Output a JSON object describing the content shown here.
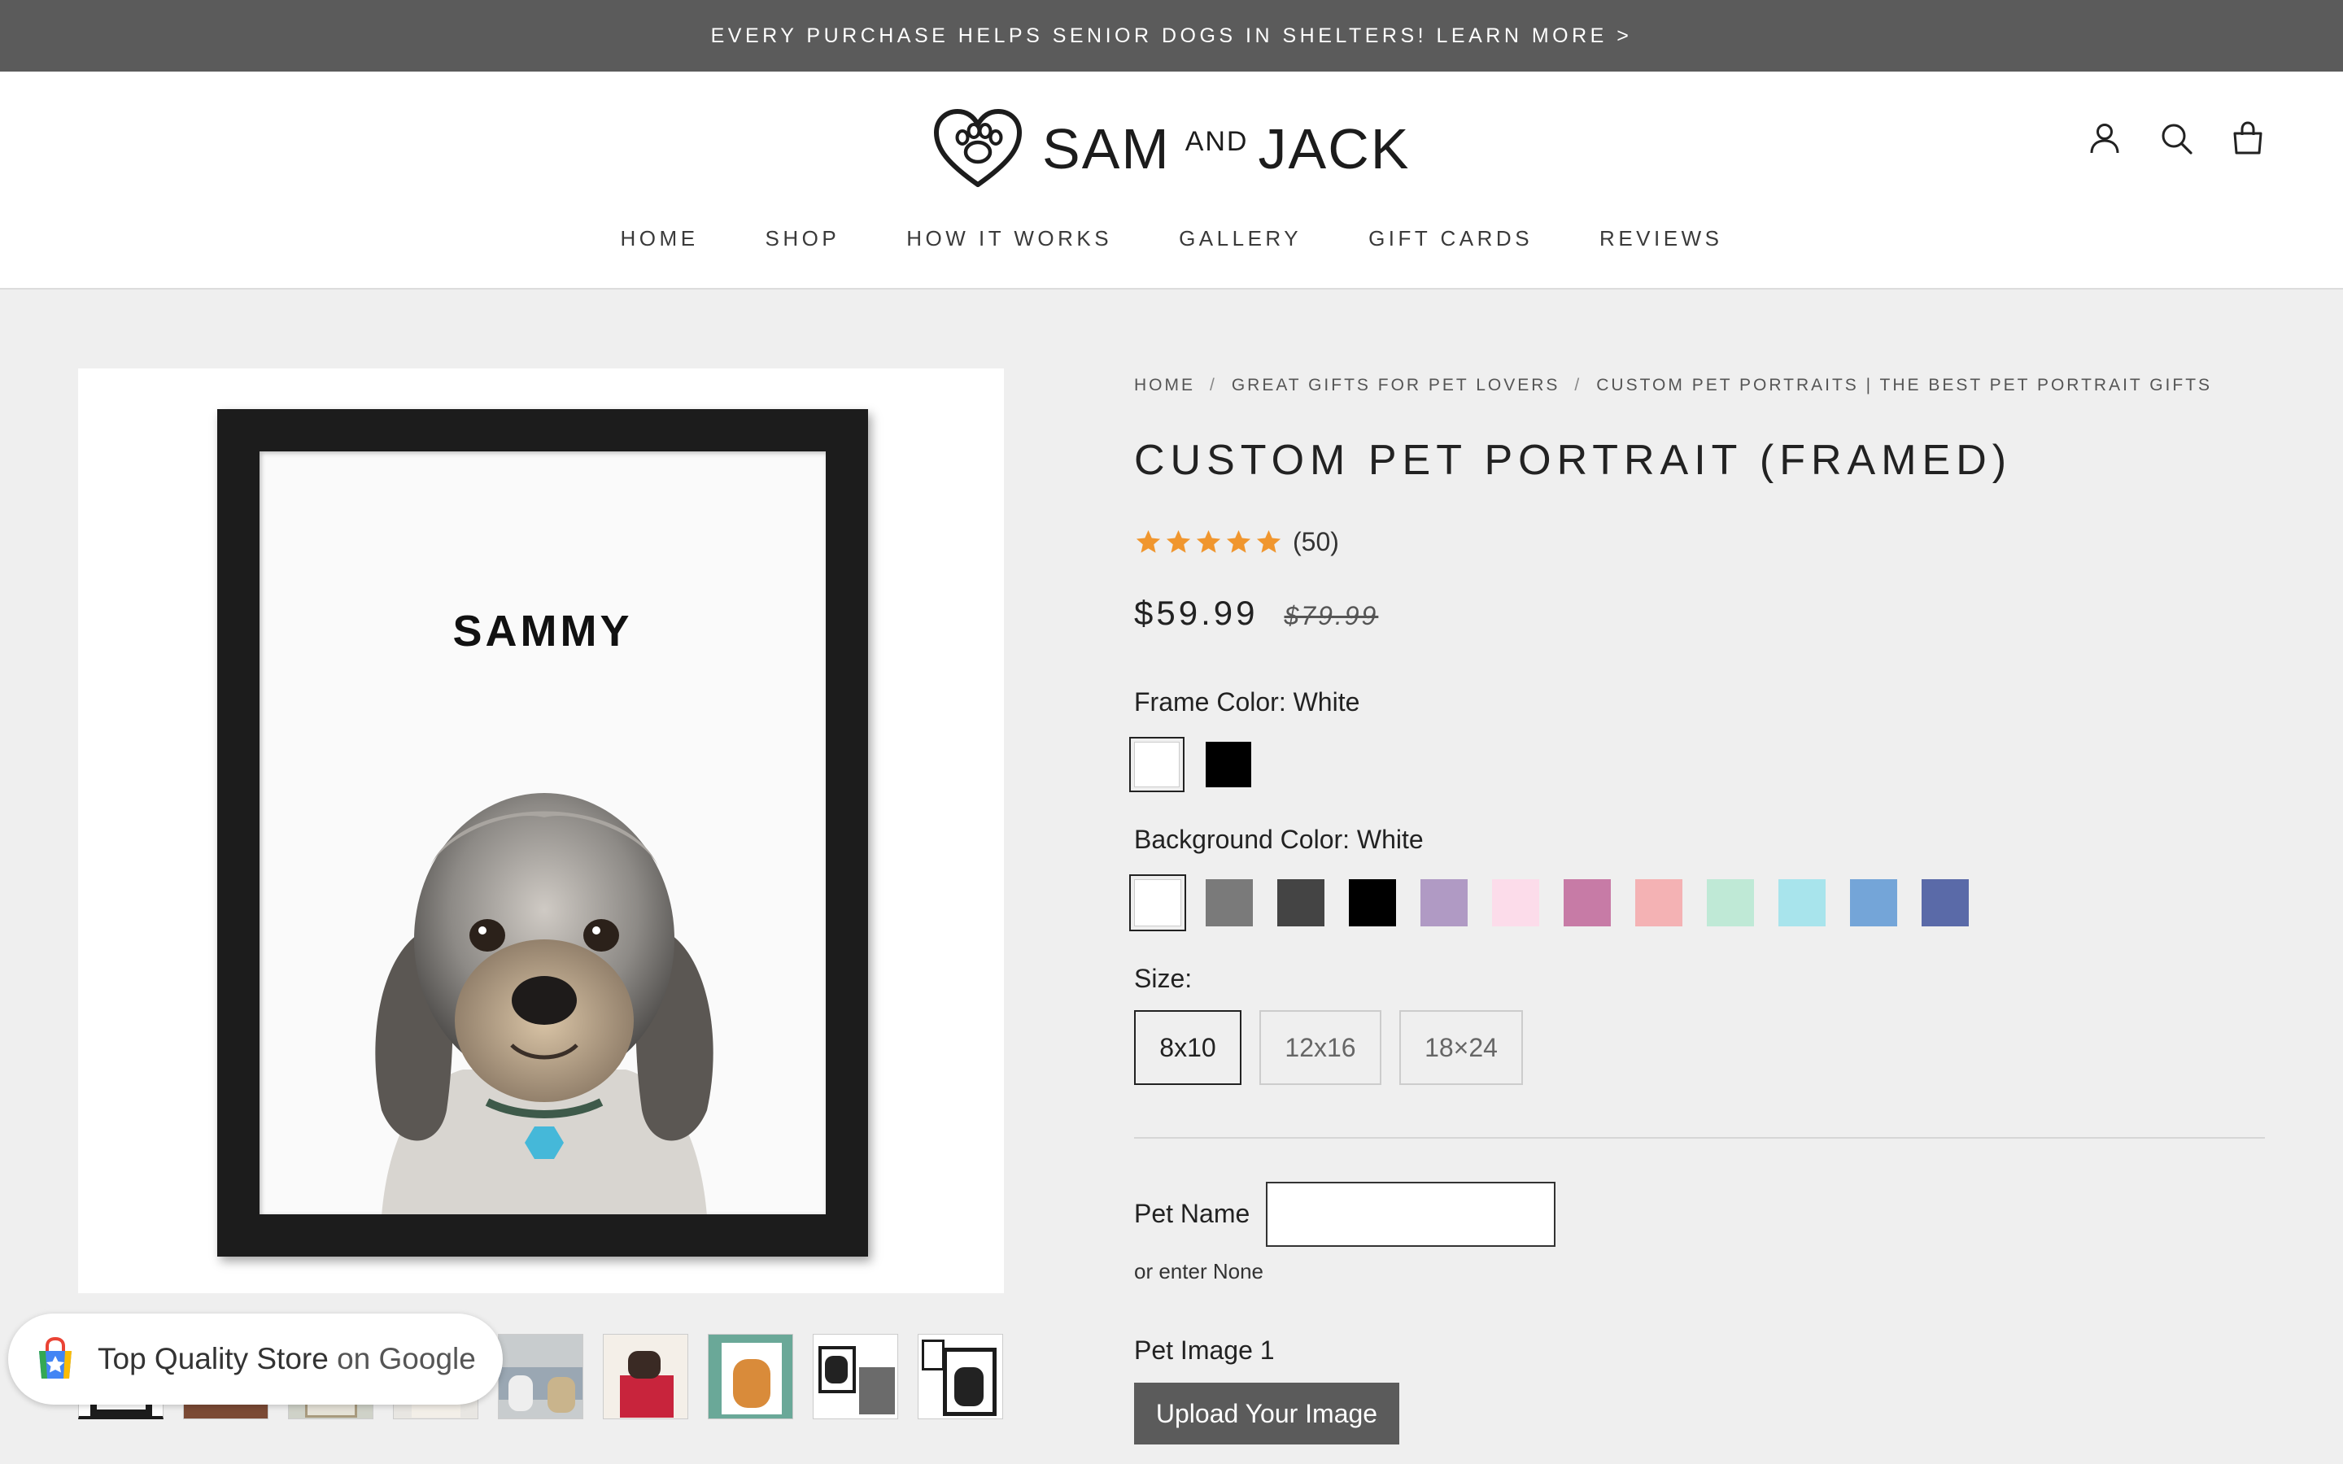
{
  "announcement": {
    "text": "EVERY PURCHASE HELPS SENIOR DOGS IN SHELTERS! LEARN MORE >"
  },
  "brand": {
    "name_left": "SAM",
    "name_mid": "AND",
    "name_right": "JACK",
    "logo_icon": "heart-paw-icon"
  },
  "header_icons": [
    {
      "name": "account-icon"
    },
    {
      "name": "search-icon"
    },
    {
      "name": "cart-icon"
    }
  ],
  "nav": [
    "HOME",
    "SHOP",
    "HOW IT WORKS",
    "GALLERY",
    "GIFT CARDS",
    "REVIEWS"
  ],
  "gallery": {
    "main_image_text": "SAMMY",
    "thumbnail_count": 9
  },
  "google_badge": {
    "text_main": "Top Quality Store",
    "text_on": "on Google"
  },
  "breadcrumb": [
    "HOME",
    "GREAT GIFTS FOR PET LOVERS",
    "CUSTOM PET PORTRAITS | THE BEST PET PORTRAIT GIFTS"
  ],
  "breadcrumb_sep": "/",
  "product": {
    "title": "CUSTOM PET PORTRAIT (FRAMED)",
    "rating": 5,
    "review_count": "(50)",
    "price": "$59.99",
    "compare_price": "$79.99"
  },
  "options": {
    "frame_color": {
      "label": "Frame Color: White",
      "swatches": [
        "#ffffff",
        "#000000"
      ],
      "selected": 0
    },
    "background_color": {
      "label": "Background Color: White",
      "swatches": [
        "#ffffff",
        "#7a7a7a",
        "#444444",
        "#000000",
        "#b09ac4",
        "#fcdcea",
        "#c77ba6",
        "#f4b2b4",
        "#bfe9d6",
        "#a8e4ec",
        "#74a5d8",
        "#5a6aa8"
      ],
      "selected": 0
    },
    "size": {
      "label": "Size:",
      "values": [
        "8x10",
        "12x16",
        "18×24"
      ],
      "selected": 0
    }
  },
  "personalize": {
    "pet_name_label": "Pet Name",
    "pet_name_value": "",
    "helper_text": "or enter None",
    "pet_image_label": "Pet Image 1",
    "upload_label": "Upload Your Image"
  },
  "colors": {
    "accent_star": "#f0962e",
    "announce_bg": "#5b5b5b",
    "upload_bg": "#5b5b5b"
  }
}
